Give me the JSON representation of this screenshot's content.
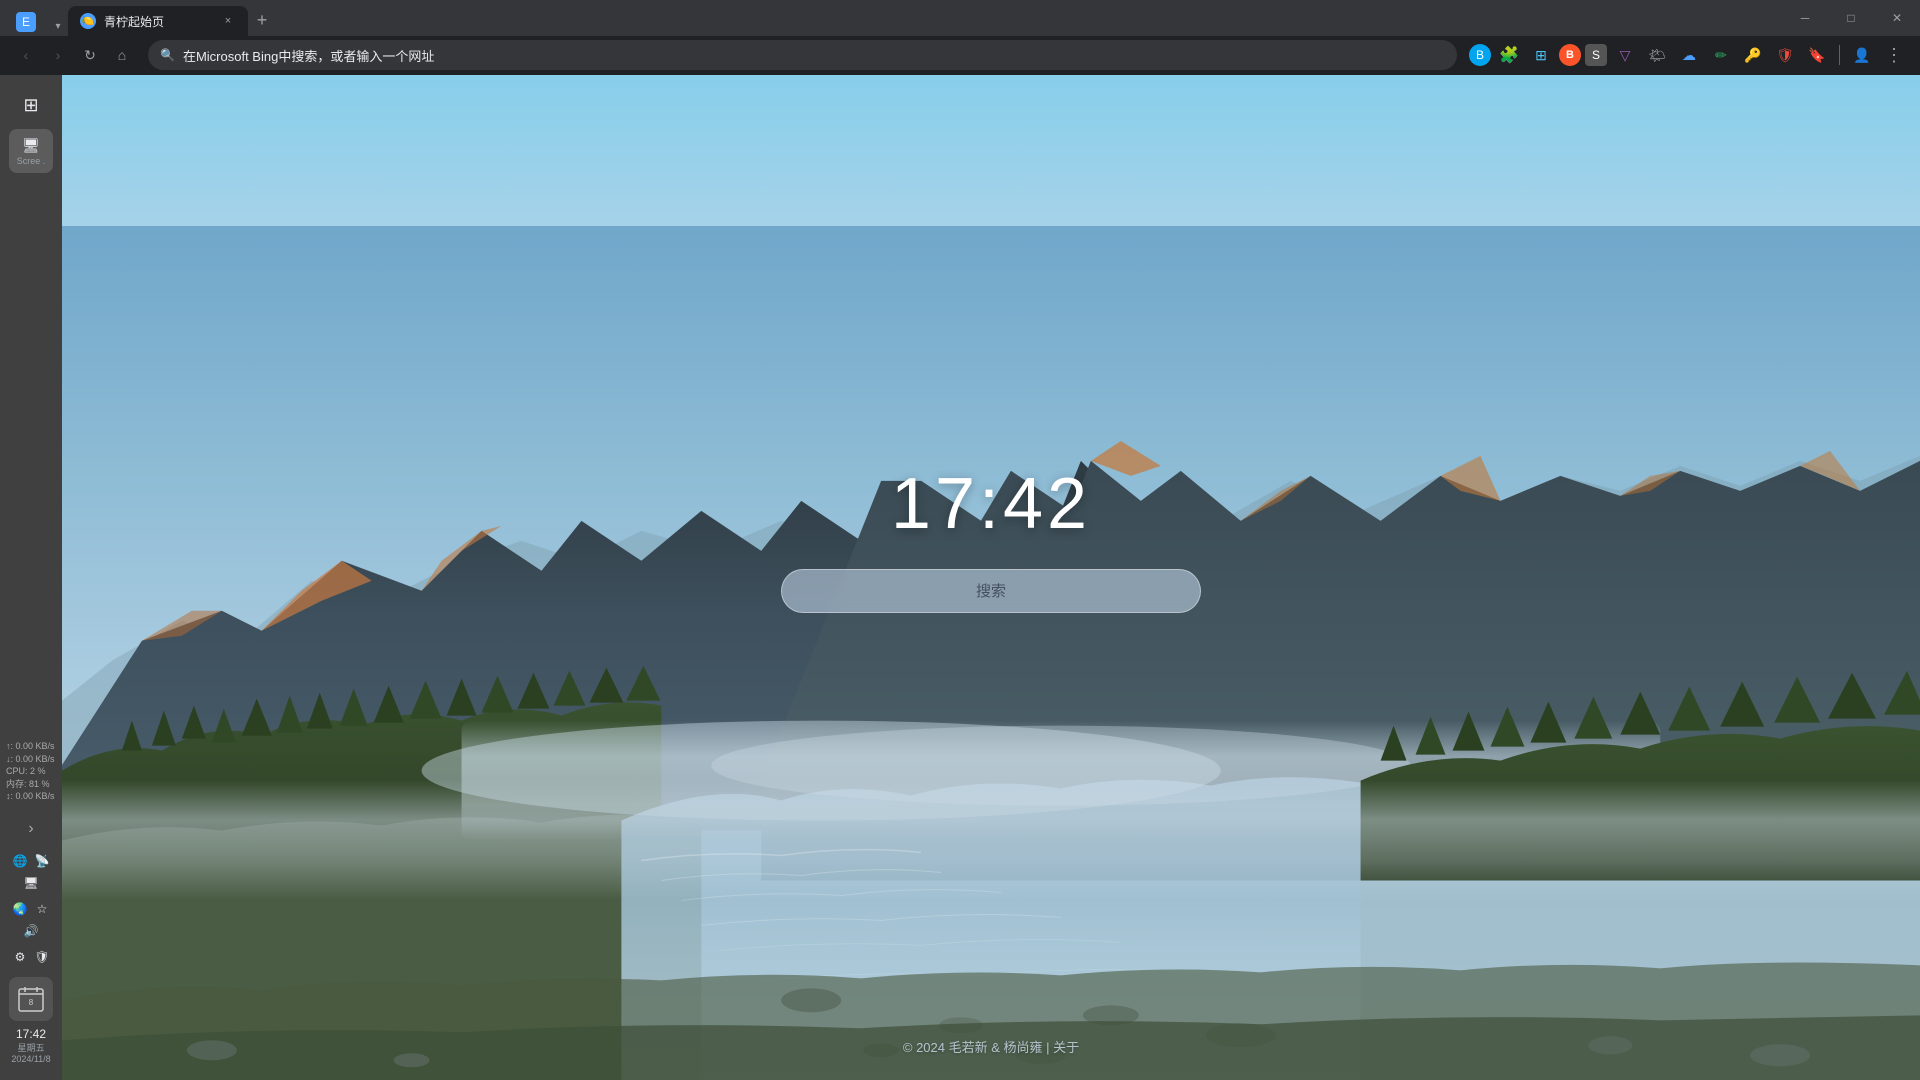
{
  "browser": {
    "tab": {
      "favicon": "🌐",
      "title": "青柠起始页",
      "close_label": "×"
    },
    "new_tab_label": "+",
    "window_controls": {
      "minimize": "─",
      "maximize": "□",
      "close": "✕"
    },
    "nav": {
      "back_label": "‹",
      "forward_label": "›",
      "refresh_label": "↻",
      "home_label": "⌂"
    },
    "address_bar": {
      "url": "在Microsoft Bing中搜索，或者输入一个网址",
      "lock_icon": "🔍"
    },
    "toolbar_icons": [
      "⚙",
      "🧩",
      "📑",
      "B",
      "S",
      "V",
      "🌤",
      "☁",
      "✏",
      "K",
      "🛡",
      "🔖",
      "👤",
      "⋮"
    ]
  },
  "sidebar": {
    "top_icon": "⊞",
    "screen_label": "Scree .",
    "active_label": "Scree...",
    "stats": {
      "upload": "↑: 0.00 KB/s",
      "download": "↓: 0.00 KB/s",
      "cpu": "CPU: 2 %",
      "memory": "内存: 81 %",
      "disk": "↕: 0.00 KB/s"
    },
    "bottom_icons": [
      "🌐",
      "📡",
      "🖥",
      "🌏",
      "🔊",
      "⚙"
    ],
    "time": "17:42",
    "weekday": "星期五",
    "date": "2024/11/8"
  },
  "newtab": {
    "clock": "17:42",
    "search_placeholder": "搜索",
    "footer": "© 2024 毛若新 & 杨尚雍 | 关于"
  },
  "colors": {
    "browser_bg": "#202124",
    "tab_active_bg": "#202124",
    "tab_bar_bg": "#35363a",
    "address_bar_bg": "#35363a",
    "sky_top": "#87CEEB",
    "sky_mid": "#B0D4E8",
    "mist": "#C8DDE8"
  }
}
